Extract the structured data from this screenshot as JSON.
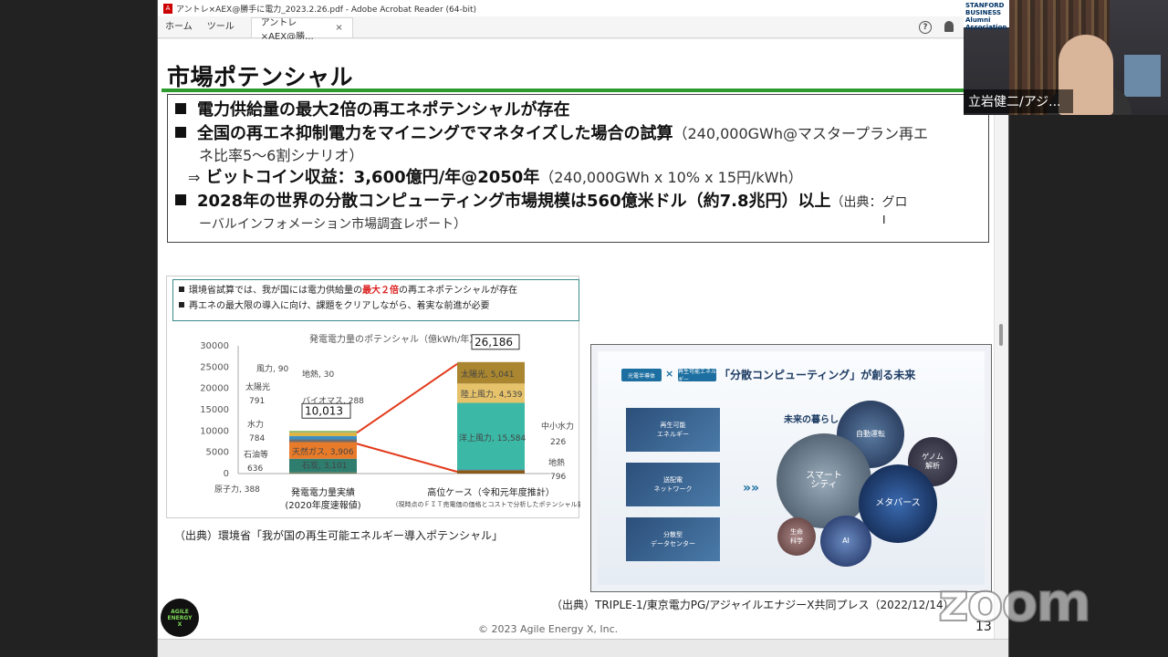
{
  "app": {
    "window_title": "アントレ×AEX@勝手に電力_2023.2.26.pdf - Adobe Acrobat Reader (64-bit)",
    "nav_home": "ホーム",
    "nav_tools": "ツール",
    "doc_tab": "アントレ×AEX@勝...",
    "doc_tab_close": "×",
    "help_icon": "?"
  },
  "slide": {
    "title": "市場ポテンシャル",
    "bullets": [
      {
        "bold": "電力供給量の最大2倍の再エネポテンシャルが存在",
        "note": ""
      },
      {
        "bold": "全国の再エネ抑制電力をマイニングでマネタイズした場合の試算",
        "note": "（240,000GWh@マスタープラン再エ",
        "cont": "ネ比率5～6割シナリオ）"
      },
      {
        "arrow": "⇒",
        "bold": "ビットコイン収益：3,600億円/年@2050年",
        "note": "（240,000GWh x 10% x 15円/kWh）"
      },
      {
        "bold": "2028年の世界の分散コンピューティング市場規模は560億米ドル（約7.8兆円）以上",
        "note": "（出典：グロ",
        "cont": "ーバルインフォメーション市場調査レポート）"
      }
    ],
    "fig1_head_1a": "環境省試算では、我が国には電力供給量の",
    "fig1_head_1b": "最大２倍",
    "fig1_head_1c": "の再エネポテンシャルが存在",
    "fig1_head_2": "再エネの最大限の導入に向け、課題をクリアしながら、着実な前進が必要",
    "fig1_caption": "（出典）環境省「我が国の再生可能エネルギー導入ポテンシャル」",
    "fig2": {
      "pill1": "光電半導体",
      "pill_x": "×",
      "pill2": "再生可能エネルギー",
      "title": "「分散コンピューティング」が創る未来",
      "box1": "再生可能\nエネルギー",
      "box2": "送配電\nネットワーク",
      "box3": "分散型\nデータセンター",
      "arrow": "»»",
      "future_label": "未来の暮らし",
      "b_auto": "自動運転",
      "b_game": "ゲノム\n解析",
      "b_smart": "スマート\nシティ",
      "b_meta": "メタバース",
      "b_ai": "AI",
      "b_life": "生命\n科学"
    },
    "fig2_caption": "（出典）TRIPLE-1/東京電力PG/アジャイルエナジーX共同プレス（2022/12/14）",
    "copyright": "© 2023 Agile Energy X, Inc.",
    "page_number": "13",
    "logo": [
      "AGILE",
      "ENERGY",
      "X"
    ]
  },
  "chart_data": {
    "type": "bar",
    "title": "発電電力量のポテンシャル（億kWh/年）",
    "ylim": [
      0,
      30000
    ],
    "yticks": [
      "30000",
      "25000",
      "20000",
      "15000",
      "10000",
      "5000",
      "0"
    ],
    "categories": [
      "発電電力量実績\n(2020年度速報値)",
      "高位ケース（令和元年度推計）"
    ],
    "category_notes": [
      "",
      "(現時点のＦＩＴ売電価の価格とコストで分析したポテンシャル量)"
    ],
    "totals": [
      "10,013",
      "26,186"
    ],
    "series_actual": [
      {
        "name": "原子力",
        "value": 388
      },
      {
        "name": "石炭",
        "value": 3101
      },
      {
        "name": "天然ガス",
        "value": 3906
      },
      {
        "name": "石油等",
        "value": 636
      },
      {
        "name": "水力",
        "value": 784
      },
      {
        "name": "太陽光",
        "value": 791
      },
      {
        "name": "風力",
        "value": 90
      },
      {
        "name": "地熱",
        "value": 30
      },
      {
        "name": "バイオマス",
        "value": 288
      }
    ],
    "series_potential": [
      {
        "name": "地熱",
        "value": 796
      },
      {
        "name": "中小水力",
        "value": 226
      },
      {
        "name": "洋上風力",
        "value": 15584
      },
      {
        "name": "陸上風力",
        "value": 4539
      },
      {
        "name": "太陽光",
        "value": 5041
      }
    ],
    "labels_actual": {
      "wind": "風力, 90",
      "geo": "地熱, 30",
      "solar": "太陽光",
      "solar_v": "791",
      "bio": "バイオマス, 288",
      "hydro": "水力",
      "hydro_v": "784",
      "oil": "石油等",
      "oil_v": "636",
      "gas": "天然ガス, 3,906",
      "coal": "石炭, 3,101",
      "nuclear": "原子力, 388"
    },
    "labels_potential": {
      "solar": "太陽光, 5,041",
      "onshore": "陸上風力, 4,539",
      "offshore": "洋上風力, 15,584",
      "smallhydro": "中小水力",
      "smallhydro_v": "226",
      "geo": "地熱",
      "geo_v": "796"
    },
    "colors": {
      "nuclear": "#5a7a5a",
      "coal": "#2e7d6e",
      "gas": "#e87b2a",
      "oil": "#6c6c6c",
      "hydro": "#3b8fc4",
      "solar": "#e0b23b",
      "wind": "#86c79a",
      "geo": "#b35a2e",
      "bio": "#7fb04a",
      "offshore": "#3bb8a6",
      "onshore": "#e6c36b",
      "p_solar": "#a9862f",
      "p_geo": "#8a5a1a",
      "p_small": "#2a8aa0"
    }
  },
  "video": {
    "name": "立岩健二/アジ...",
    "poster": "STANFORD\nBUSINESS\nAlumni Association"
  },
  "watermark": "zoom"
}
